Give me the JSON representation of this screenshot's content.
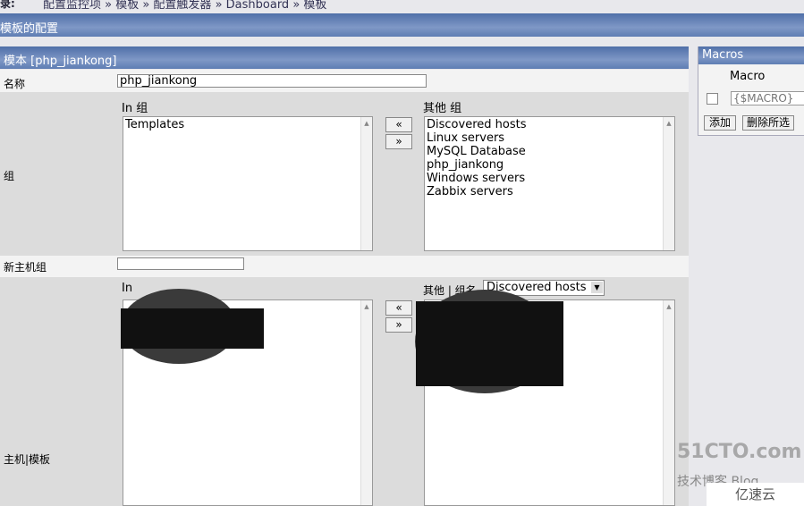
{
  "history": {
    "label": "录:",
    "breadcrumb": "配置监控项 » 模板 » 配置触发器 » Dashboard » 模板"
  },
  "page_title": "模板的配置",
  "form": {
    "header": "模本  [php_jiankong]",
    "name_label": "名称",
    "name_value": "php_jiankong",
    "group_label": "组",
    "in_group_label": "In 组",
    "other_group_label": "其他 组",
    "in_groups": [
      "Templates"
    ],
    "other_groups": [
      "Discovered hosts",
      "Linux servers",
      "MySQL Database",
      "php_jiankong",
      "Windows servers",
      "Zabbix servers"
    ],
    "move_left": "«",
    "move_right": "»",
    "new_group_label": "新主机组",
    "new_group_value": "",
    "hosts_label": "主机|模板",
    "in_label": "In",
    "other_hosts_label": "其他 | 组名",
    "group_select": "Discovered hosts"
  },
  "macros": {
    "title": "Macros",
    "column": "Macro",
    "placeholder": "{$MACRO}",
    "add": "添加",
    "delete": "删除所选"
  },
  "watermark": {
    "brand": "51CTO.com",
    "sub": "技术博客  Blog",
    "logo": "亿速云"
  }
}
